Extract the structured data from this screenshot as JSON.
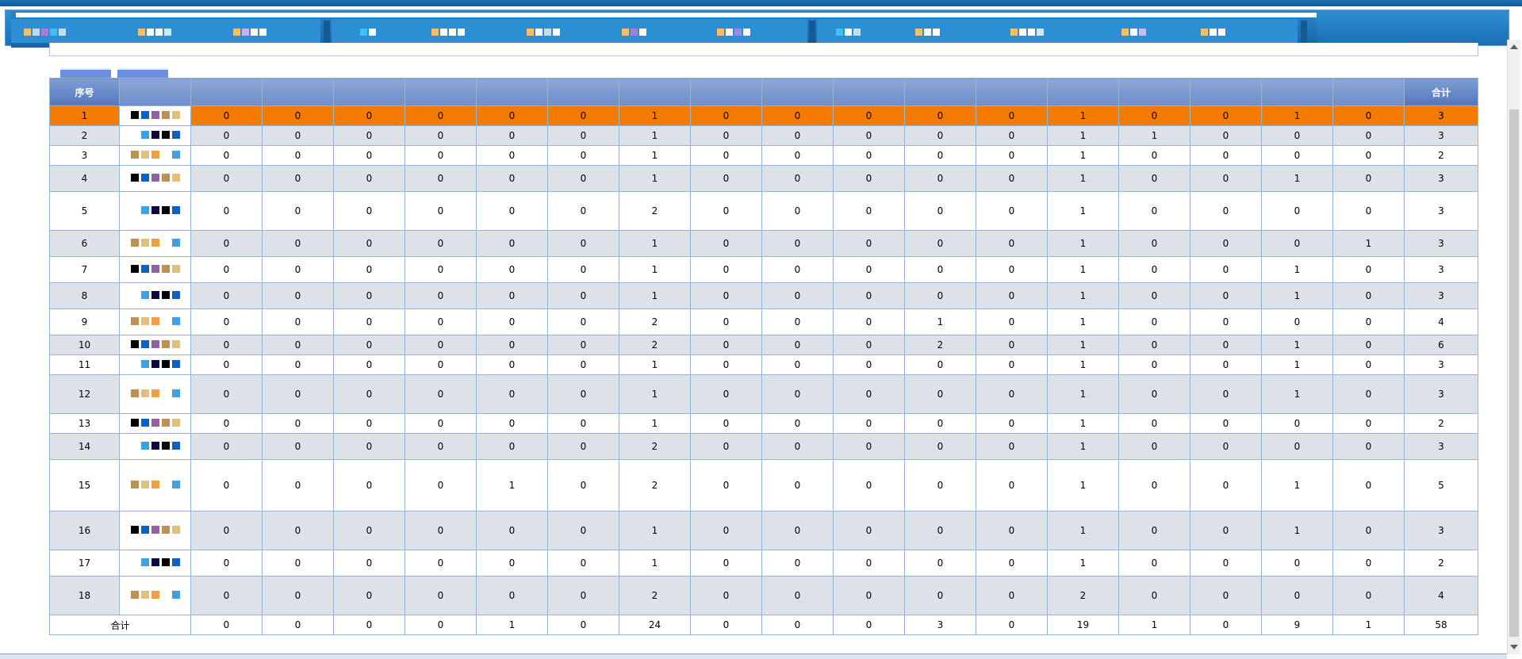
{
  "colors": {
    "header_bg": "#6a89c9",
    "row_alt": "#dde2e8",
    "row_selected": "#f57a00",
    "grid_border": "#98b4d4",
    "nav_blue": "#1f78bf"
  },
  "table": {
    "header_index": "序号",
    "header_total": "合计",
    "rows": [
      {
        "index": "1",
        "values": [
          "0",
          "0",
          "0",
          "0",
          "0",
          "0",
          "1",
          "0",
          "0",
          "0",
          "0",
          "0",
          "1",
          "0",
          "0",
          "1",
          "0"
        ],
        "total": "3",
        "selected": true,
        "h": 25
      },
      {
        "index": "2",
        "values": [
          "0",
          "0",
          "0",
          "0",
          "0",
          "0",
          "1",
          "0",
          "0",
          "0",
          "0",
          "0",
          "1",
          "1",
          "0",
          "0",
          "0"
        ],
        "total": "3",
        "h": 25
      },
      {
        "index": "3",
        "values": [
          "0",
          "0",
          "0",
          "0",
          "0",
          "0",
          "1",
          "0",
          "0",
          "0",
          "0",
          "0",
          "1",
          "0",
          "0",
          "0",
          "0"
        ],
        "total": "2",
        "h": 25
      },
      {
        "index": "4",
        "values": [
          "0",
          "0",
          "0",
          "0",
          "0",
          "0",
          "1",
          "0",
          "0",
          "0",
          "0",
          "0",
          "1",
          "0",
          "0",
          "1",
          "0"
        ],
        "total": "3",
        "h": 33
      },
      {
        "index": "5",
        "values": [
          "0",
          "0",
          "0",
          "0",
          "0",
          "0",
          "2",
          "0",
          "0",
          "0",
          "0",
          "0",
          "1",
          "0",
          "0",
          "0",
          "0"
        ],
        "total": "3",
        "h": 49
      },
      {
        "index": "6",
        "values": [
          "0",
          "0",
          "0",
          "0",
          "0",
          "0",
          "1",
          "0",
          "0",
          "0",
          "0",
          "0",
          "1",
          "0",
          "0",
          "0",
          "1"
        ],
        "total": "3",
        "h": 33
      },
      {
        "index": "7",
        "values": [
          "0",
          "0",
          "0",
          "0",
          "0",
          "0",
          "1",
          "0",
          "0",
          "0",
          "0",
          "0",
          "1",
          "0",
          "0",
          "1",
          "0"
        ],
        "total": "3",
        "h": 33
      },
      {
        "index": "8",
        "values": [
          "0",
          "0",
          "0",
          "0",
          "0",
          "0",
          "1",
          "0",
          "0",
          "0",
          "0",
          "0",
          "1",
          "0",
          "0",
          "1",
          "0"
        ],
        "total": "3",
        "h": 33
      },
      {
        "index": "9",
        "values": [
          "0",
          "0",
          "0",
          "0",
          "0",
          "0",
          "2",
          "0",
          "0",
          "0",
          "1",
          "0",
          "1",
          "0",
          "0",
          "0",
          "0"
        ],
        "total": "4",
        "h": 33
      },
      {
        "index": "10",
        "values": [
          "0",
          "0",
          "0",
          "0",
          "0",
          "0",
          "2",
          "0",
          "0",
          "0",
          "2",
          "0",
          "1",
          "0",
          "0",
          "1",
          "0"
        ],
        "total": "6",
        "h": 25
      },
      {
        "index": "11",
        "values": [
          "0",
          "0",
          "0",
          "0",
          "0",
          "0",
          "1",
          "0",
          "0",
          "0",
          "0",
          "0",
          "1",
          "0",
          "0",
          "1",
          "0"
        ],
        "total": "3",
        "h": 25
      },
      {
        "index": "12",
        "values": [
          "0",
          "0",
          "0",
          "0",
          "0",
          "0",
          "1",
          "0",
          "0",
          "0",
          "0",
          "0",
          "1",
          "0",
          "0",
          "1",
          "0"
        ],
        "total": "3",
        "h": 49
      },
      {
        "index": "13",
        "values": [
          "0",
          "0",
          "0",
          "0",
          "0",
          "0",
          "1",
          "0",
          "0",
          "0",
          "0",
          "0",
          "1",
          "0",
          "0",
          "0",
          "0"
        ],
        "total": "2",
        "h": 25
      },
      {
        "index": "14",
        "values": [
          "0",
          "0",
          "0",
          "0",
          "0",
          "0",
          "2",
          "0",
          "0",
          "0",
          "0",
          "0",
          "1",
          "0",
          "0",
          "0",
          "0"
        ],
        "total": "3",
        "h": 33
      },
      {
        "index": "15",
        "values": [
          "0",
          "0",
          "0",
          "0",
          "1",
          "0",
          "2",
          "0",
          "0",
          "0",
          "0",
          "0",
          "1",
          "0",
          "0",
          "1",
          "0"
        ],
        "total": "5",
        "h": 65
      },
      {
        "index": "16",
        "values": [
          "0",
          "0",
          "0",
          "0",
          "0",
          "0",
          "1",
          "0",
          "0",
          "0",
          "0",
          "0",
          "1",
          "0",
          "0",
          "1",
          "0"
        ],
        "total": "3",
        "h": 49
      },
      {
        "index": "17",
        "values": [
          "0",
          "0",
          "0",
          "0",
          "0",
          "0",
          "1",
          "0",
          "0",
          "0",
          "0",
          "0",
          "1",
          "0",
          "0",
          "0",
          "0"
        ],
        "total": "2",
        "h": 33
      },
      {
        "index": "18",
        "values": [
          "0",
          "0",
          "0",
          "0",
          "0",
          "0",
          "2",
          "0",
          "0",
          "0",
          "0",
          "0",
          "2",
          "0",
          "0",
          "0",
          "0"
        ],
        "total": "4",
        "h": 49
      }
    ],
    "footer": {
      "label": "合计",
      "values": [
        "0",
        "0",
        "0",
        "0",
        "1",
        "0",
        "24",
        "0",
        "0",
        "0",
        "3",
        "0",
        "19",
        "1",
        "0",
        "9",
        "1"
      ],
      "total": "58"
    }
  }
}
